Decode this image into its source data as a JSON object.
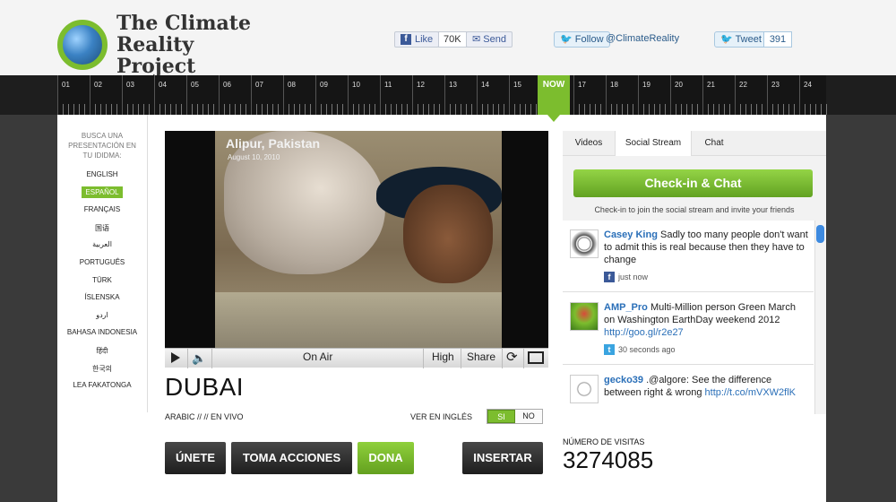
{
  "header": {
    "logo_text": "The Climate Reality Project",
    "fb_like_label": "Like",
    "fb_like_count": "70K",
    "fb_send_label": "Send",
    "tw_follow_label": "Follow",
    "tw_handle": "@ClimateReality",
    "tw_tweet_label": "Tweet",
    "tw_tweet_count": "391"
  },
  "timeline": {
    "hours": [
      "01",
      "02",
      "03",
      "04",
      "05",
      "06",
      "07",
      "08",
      "09",
      "10",
      "11",
      "12",
      "13",
      "14",
      "15",
      "17",
      "18",
      "19",
      "20",
      "21",
      "22",
      "23",
      "24"
    ],
    "now_label": "NOW"
  },
  "languages": {
    "prompt": "BUSCA UNA PRESENTACIÓN EN TU IDIDMA:",
    "items": [
      "ENGLISH",
      "ESPAÑOL",
      "FRANÇAIS",
      "国语",
      "العربية",
      "PORTUGUÊS",
      "TÜRK",
      "ÍSLENSKA",
      "اردو",
      "BAHASA INDONESIA",
      "हिंदी",
      "한국의",
      "LEA FAKATONGA"
    ],
    "active": "ESPAÑOL"
  },
  "player": {
    "photo_title": "Alipur, Pakistan",
    "photo_date": "August 10, 2010",
    "status": "On Air",
    "quality": "High",
    "share": "Share"
  },
  "presentation": {
    "city": "DUBAI",
    "meta": "ARABIC // // EN VIVO",
    "english_label": "VER EN INGLÉS",
    "yes": "SI",
    "no": "NO"
  },
  "actions": {
    "join": "ÚNETE",
    "act": "TOMA ACCIONES",
    "donate": "DONA",
    "embed": "INSERTAR"
  },
  "panel": {
    "tabs": [
      "Videos",
      "Social Stream",
      "Chat"
    ],
    "active_tab": "Social Stream",
    "checkin_button": "Check-in & Chat",
    "checkin_sub": "Check-in to join the social stream and invite your friends",
    "posts": [
      {
        "user": "Casey King",
        "text": "Sadly too many people don't want to admit this is real because then they have to change",
        "link": "",
        "time": "just now",
        "source": "facebook"
      },
      {
        "user": "AMP_Pro",
        "text": "Multi-Million person Green March on Washington EarthDay weekend 2012",
        "link": "http://goo.gl/r2e27",
        "time": "30 seconds ago",
        "source": "twitter"
      },
      {
        "user": "gecko39",
        "text": ".@algore: See the difference between right & wrong",
        "link": "http://t.co/mVXW2flK",
        "time": "",
        "source": "twitter"
      }
    ]
  },
  "visits": {
    "label": "NÚMERO DE VISITAS",
    "count": "3274085"
  },
  "colors": {
    "accent_green": "#7cbd2e",
    "link_blue": "#2a6fb8",
    "timeline_dark": "#151515"
  }
}
